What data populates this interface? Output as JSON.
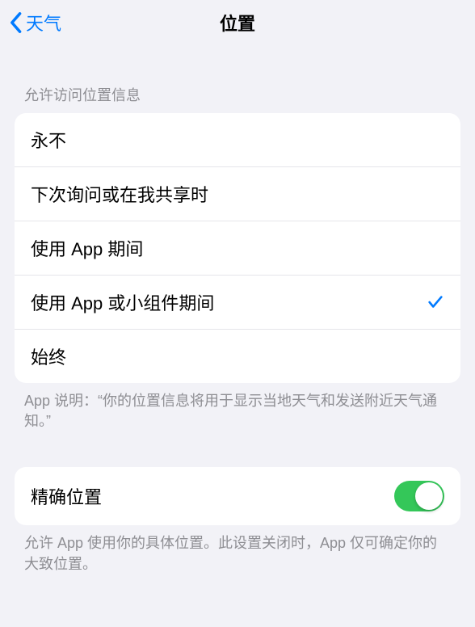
{
  "nav": {
    "back_label": "天气",
    "title": "位置"
  },
  "sections": {
    "access": {
      "header": "允许访问位置信息",
      "options": [
        {
          "label": "永不",
          "selected": false
        },
        {
          "label": "下次询问或在我共享时",
          "selected": false
        },
        {
          "label": "使用 App 期间",
          "selected": false
        },
        {
          "label": "使用 App 或小组件期间",
          "selected": true
        },
        {
          "label": "始终",
          "selected": false
        }
      ],
      "footer": "App 说明：“你的位置信息将用于显示当地天气和发送附近天气通知。”"
    },
    "precise": {
      "label": "精确位置",
      "enabled": true,
      "footer": "允许 App 使用你的具体位置。此设置关闭时，App 仅可确定你的大致位置。"
    }
  }
}
